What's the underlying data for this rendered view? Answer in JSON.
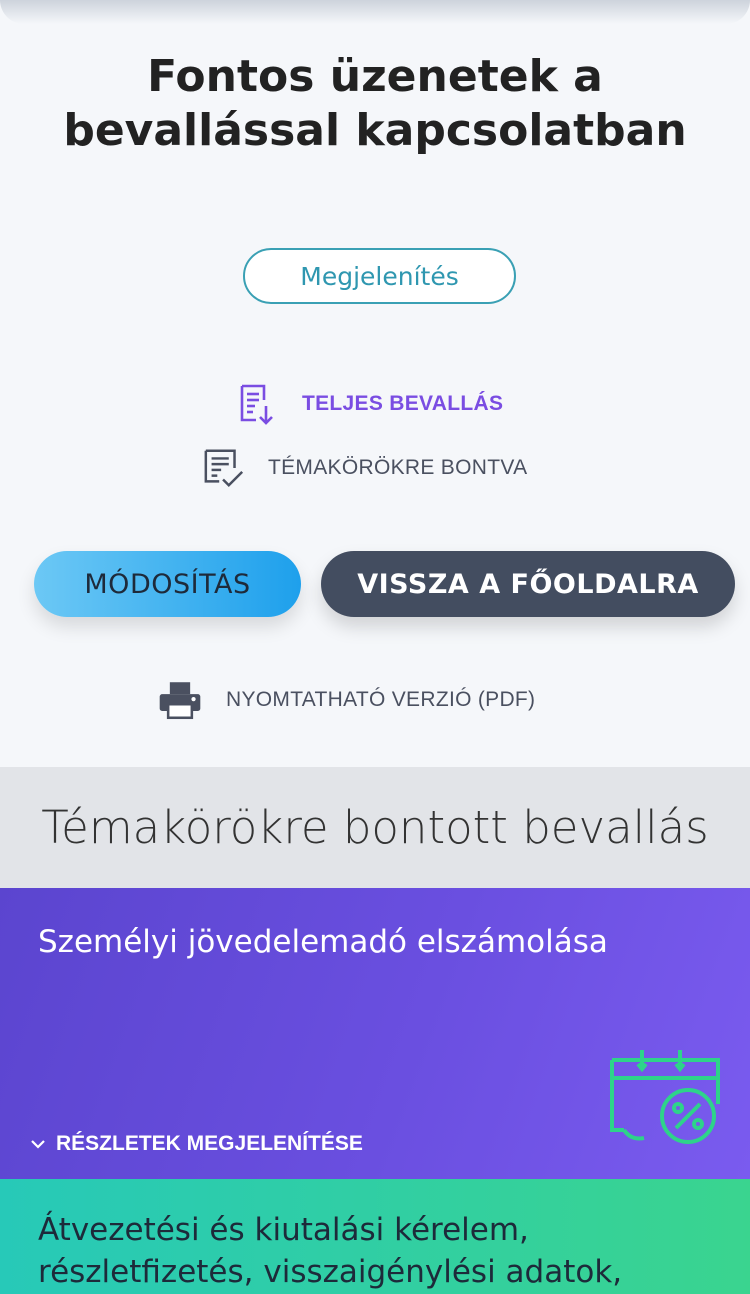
{
  "page_title": "Fontos üzenetek a bevallással kapcsolatban",
  "show_button": "Megjelenítés",
  "links": {
    "full_return": "TELJES BEVALLÁS",
    "by_topics": "TÉMAKÖRÖKRE BONTVA",
    "printable": "NYOMTATHATÓ VERZIÓ (PDF)"
  },
  "buttons": {
    "modify": "MÓDOSÍTÁS",
    "back_home": "VISSZA A FŐOLDALRA"
  },
  "section_title": "Témakörökre bontott bevallás",
  "cards": [
    {
      "title": "Személyi jövedelemadó elszámolása",
      "details_label": "RÉSZLETEK MEGJELENÍTÉSE",
      "icon": "calendar-percent-icon"
    },
    {
      "title": "Átvezetési és kiutalási kérelem, részletfizetés, visszaigénylési adatok,"
    }
  ],
  "colors": {
    "accent_purple": "#7a4de2",
    "accent_teal": "#2f97b0",
    "card_purple": "#6a4fe0",
    "card_green": "#2fcfa4",
    "icon_green": "#2ed38a"
  }
}
